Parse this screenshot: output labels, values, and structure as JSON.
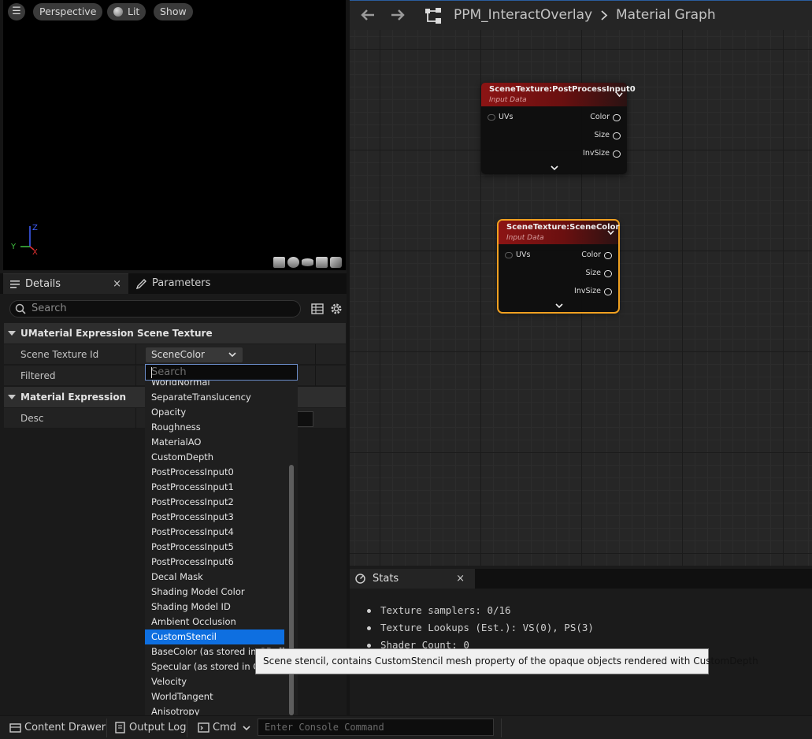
{
  "viewport": {
    "perspective_label": "Perspective",
    "lit_label": "Lit",
    "show_label": "Show",
    "axis": {
      "y": "Y",
      "z": "Z",
      "x": "X"
    },
    "colors": {
      "axis_x": "#e03030",
      "axis_y": "#40c040",
      "axis_z": "#4060ff"
    }
  },
  "details": {
    "tabs": {
      "details": "Details",
      "parameters": "Parameters",
      "close": "×"
    },
    "search_placeholder": "Search",
    "categories": {
      "scene_texture": "UMaterial Expression Scene Texture",
      "material_expression": "Material Expression"
    },
    "props": {
      "scene_texture_id": {
        "label": "Scene Texture Id",
        "value": "SceneColor"
      },
      "filtered": {
        "label": "Filtered"
      },
      "desc": {
        "label": "Desc"
      }
    }
  },
  "dropdown": {
    "search_placeholder": "Search",
    "items": [
      "WorldNormal",
      "SeparateTranslucency",
      "Opacity",
      "Roughness",
      "MaterialAO",
      "CustomDepth",
      "PostProcessInput0",
      "PostProcessInput1",
      "PostProcessInput2",
      "PostProcessInput3",
      "PostProcessInput4",
      "PostProcessInput5",
      "PostProcessInput6",
      "Decal Mask",
      "Shading Model Color",
      "Shading Model ID",
      "Ambient Occlusion",
      "CustomStencil",
      "BaseColor (as stored in GBuffer)",
      "Specular (as stored in GBuffer)",
      "Velocity",
      "WorldTangent",
      "Anisotropy"
    ],
    "selected": "CustomStencil",
    "selection_color": "#0e6fe0"
  },
  "graph": {
    "breadcrumb": {
      "asset": "PPM_InteractOverlay",
      "graph": "Material Graph"
    },
    "nodes": [
      {
        "title": "SceneTexture:PostProcessInput0",
        "subtitle": "Input Data",
        "input": "UVs",
        "outputs": [
          "Color",
          "Size",
          "InvSize"
        ],
        "selected": false
      },
      {
        "title": "SceneTexture:SceneColor",
        "subtitle": "Input Data",
        "input": "UVs",
        "outputs": [
          "Color",
          "Size",
          "InvSize"
        ],
        "selected": true
      }
    ],
    "colors": {
      "node_header": "#8c1414",
      "selection_outline": "#f0a020"
    }
  },
  "stats": {
    "tab_label": "Stats",
    "close": "×",
    "lines": [
      "Texture samplers: 0/16",
      "Texture Lookups (Est.): VS(0), PS(3)",
      "Shader Count: 0"
    ]
  },
  "tooltip": "Scene stencil, contains CustomStencil mesh property of the opaque objects rendered with CustomDepth",
  "statusbar": {
    "content_drawer": "Content Drawer",
    "output_log": "Output Log",
    "cmd": "Cmd",
    "console_placeholder": "Enter Console Command"
  }
}
